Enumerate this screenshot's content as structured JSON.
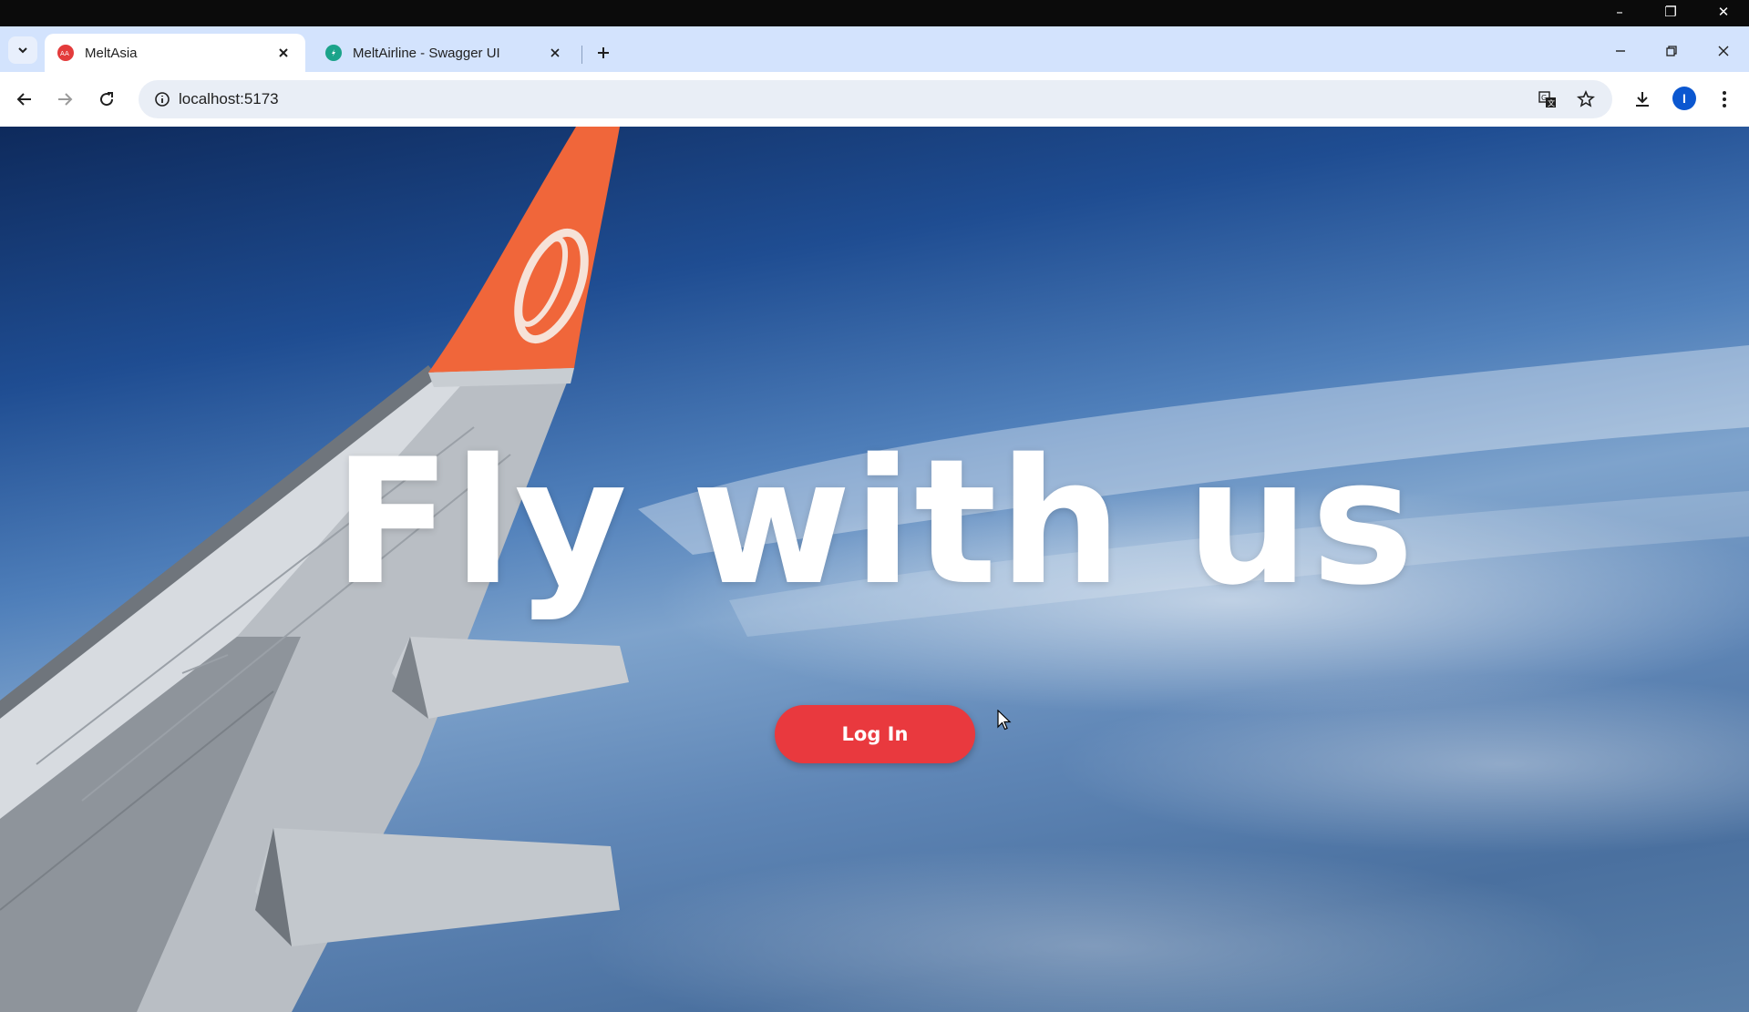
{
  "browser": {
    "tabs": [
      {
        "title": "MeltAsia",
        "favicon": "airasia-logo-icon",
        "active": true
      },
      {
        "title": "MeltAirline - Swagger UI",
        "favicon": "swagger-logo-icon",
        "active": false
      }
    ],
    "address_bar": {
      "url": "localhost:5173"
    },
    "profile_initial": "I"
  },
  "hero": {
    "title": "Fly with us",
    "login_button": "Log In"
  },
  "colors": {
    "accent_red": "#e9393e",
    "tabstrip": "#d3e3fd"
  }
}
